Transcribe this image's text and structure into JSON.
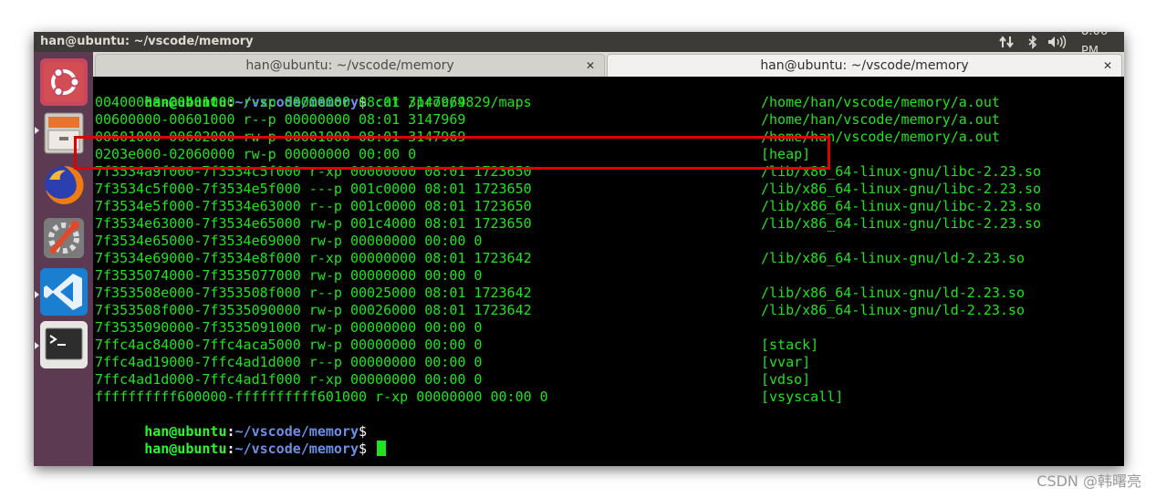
{
  "topbar": {
    "title": "han@ubuntu: ~/vscode/memory",
    "time": "8:06 PM"
  },
  "launcher": {
    "items": [
      "ubuntu-logo-icon",
      "file-cabinet-icon",
      "firefox-icon",
      "settings-wrench-icon",
      "vscode-icon",
      "terminal-icon"
    ]
  },
  "tabs": [
    {
      "label": "han@ubuntu: ~/vscode/memory",
      "active": false
    },
    {
      "label": "han@ubuntu: ~/vscode/memory",
      "active": true
    }
  ],
  "prompt": {
    "user": "han@ubuntu",
    "sep": ":",
    "dir": "~/vscode/memory",
    "sign": "$"
  },
  "command": "cat /proc/4829/maps",
  "maps": [
    {
      "text": "00400000-00401000 r-xp 00000000 08:01 3147969",
      "path": "/home/han/vscode/memory/a.out"
    },
    {
      "text": "00600000-00601000 r--p 00000000 08:01 3147969",
      "path": "/home/han/vscode/memory/a.out"
    },
    {
      "text": "00601000-00602000 rw-p 00001000 08:01 3147969",
      "path": "/home/han/vscode/memory/a.out"
    },
    {
      "text": "0203e000-02060000 rw-p 00000000 00:00 0",
      "path": "[heap]"
    },
    {
      "text": "7f3534a9f000-7f3534c5f000 r-xp 00000000 08:01 1723650",
      "path": "/lib/x86_64-linux-gnu/libc-2.23.so"
    },
    {
      "text": "7f3534c5f000-7f3534e5f000 ---p 001c0000 08:01 1723650",
      "path": "/lib/x86_64-linux-gnu/libc-2.23.so"
    },
    {
      "text": "7f3534e5f000-7f3534e63000 r--p 001c0000 08:01 1723650",
      "path": "/lib/x86_64-linux-gnu/libc-2.23.so"
    },
    {
      "text": "7f3534e63000-7f3534e65000 rw-p 001c4000 08:01 1723650",
      "path": "/lib/x86_64-linux-gnu/libc-2.23.so"
    },
    {
      "text": "7f3534e65000-7f3534e69000 rw-p 00000000 00:00 0",
      "path": ""
    },
    {
      "text": "7f3534e69000-7f3534e8f000 r-xp 00000000 08:01 1723642",
      "path": "/lib/x86_64-linux-gnu/ld-2.23.so"
    },
    {
      "text": "7f3535074000-7f3535077000 rw-p 00000000 00:00 0",
      "path": ""
    },
    {
      "text": "7f353508e000-7f353508f000 r--p 00025000 08:01 1723642",
      "path": "/lib/x86_64-linux-gnu/ld-2.23.so"
    },
    {
      "text": "7f353508f000-7f3535090000 rw-p 00026000 08:01 1723642",
      "path": "/lib/x86_64-linux-gnu/ld-2.23.so"
    },
    {
      "text": "7f3535090000-7f3535091000 rw-p 00000000 00:00 0",
      "path": ""
    },
    {
      "text": "7ffc4ac84000-7ffc4aca5000 rw-p 00000000 00:00 0",
      "path": "[stack]"
    },
    {
      "text": "7ffc4ad19000-7ffc4ad1d000 r--p 00000000 00:00 0",
      "path": "[vvar]"
    },
    {
      "text": "7ffc4ad1d000-7ffc4ad1f000 r-xp 00000000 00:00 0",
      "path": "[vdso]"
    },
    {
      "text": "ffffffffff600000-ffffffffff601000 r-xp 00000000 00:00 0",
      "path": "[vsyscall]"
    }
  ],
  "watermark": "CSDN @韩曙亮",
  "colors": {
    "highlight": "#e00000",
    "terminal_text": "#1fe31f",
    "prompt_dir": "#6d8fe8",
    "launcher_bg": "#5b3a52"
  }
}
